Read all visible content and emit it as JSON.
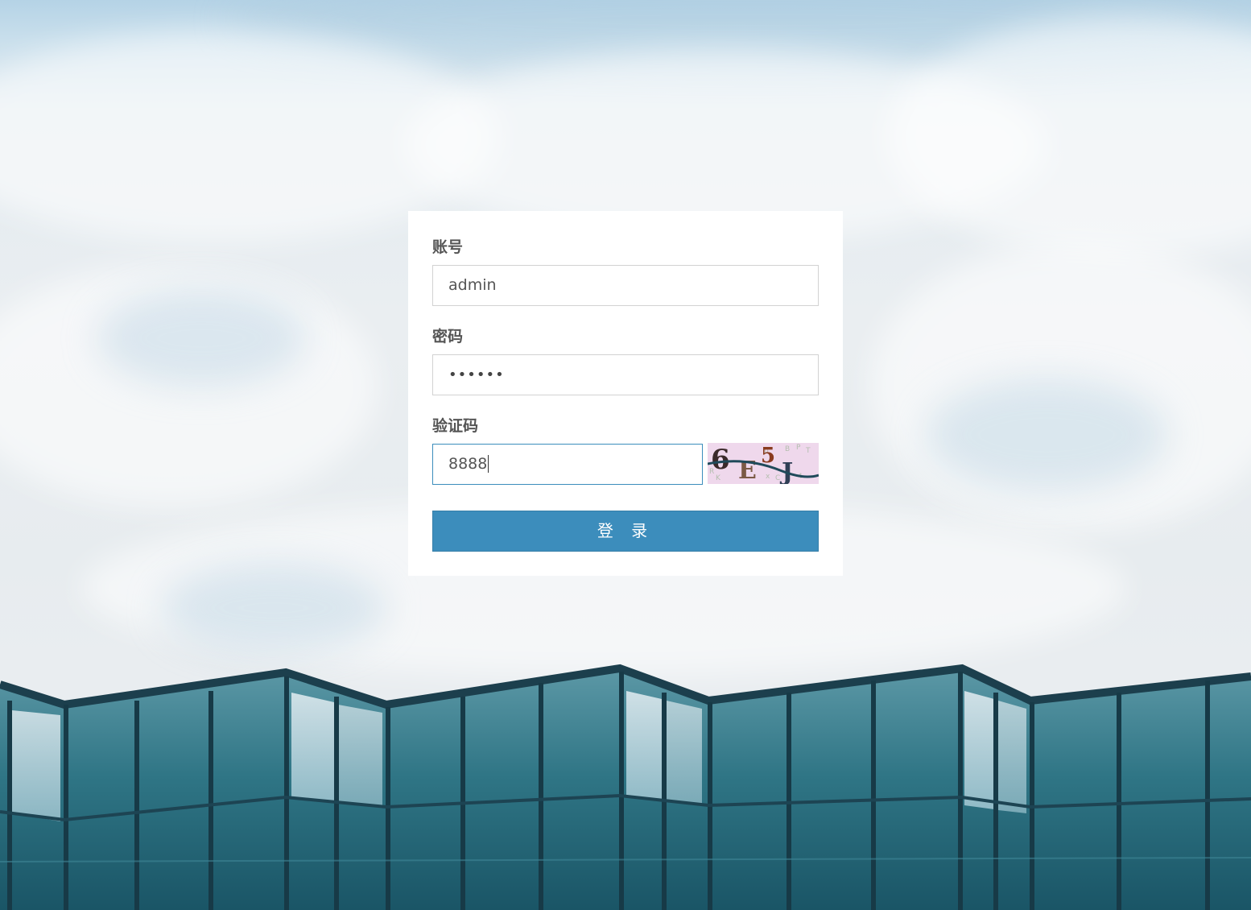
{
  "form": {
    "account_label": "账号",
    "account_value": "admin",
    "password_label": "密码",
    "password_masked": "••••••",
    "captcha_label": "验证码",
    "captcha_value": "8888",
    "captcha_image_text": "6E5J",
    "login_button": "登 录"
  },
  "colors": {
    "primary": "#3c8dbc",
    "label": "#555555",
    "input_border": "#d2d2d2",
    "captcha_bg": "#efd8ec"
  }
}
